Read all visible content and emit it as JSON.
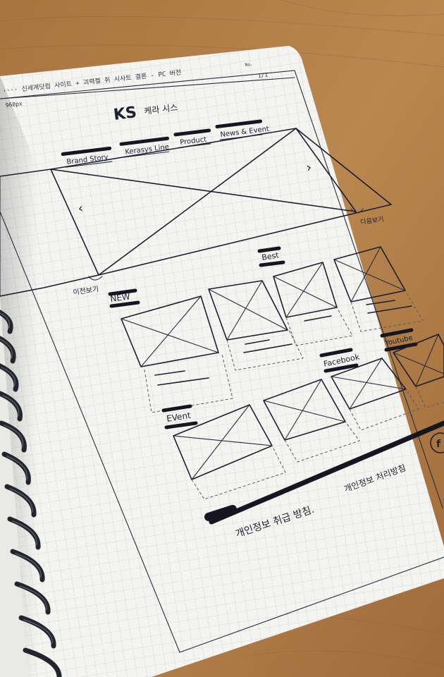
{
  "header": {
    "title_line": "···· 신세계닷컴 사이트 + 괴력켈 취 시사트   결론 - PC 버전",
    "size_note": "960px",
    "corner_note": "1/1",
    "page_mark": "No."
  },
  "logo": {
    "mark": "KS",
    "brand_text": "케라 시스"
  },
  "nav": {
    "items": [
      "Brand Story",
      "Kerasys Line",
      "Product",
      "News & Event"
    ]
  },
  "slider": {
    "prev_label": "이전보기",
    "next_label": "다음보기"
  },
  "sections": {
    "new_label": "NEW",
    "best_label": "Best",
    "event_label": "EVent",
    "facebook_label": "Facebook",
    "youtube_label": "Youtube"
  },
  "footer": {
    "privacy_1": "개인정보 취급 방침.",
    "privacy_2": "개인정보 처리방침"
  },
  "colors": {
    "desk": "#b07c4b",
    "paper": "#f4f4f1",
    "grid": "#cfd4da",
    "ink": "#1d1f2e",
    "spiral": "#23252d"
  }
}
